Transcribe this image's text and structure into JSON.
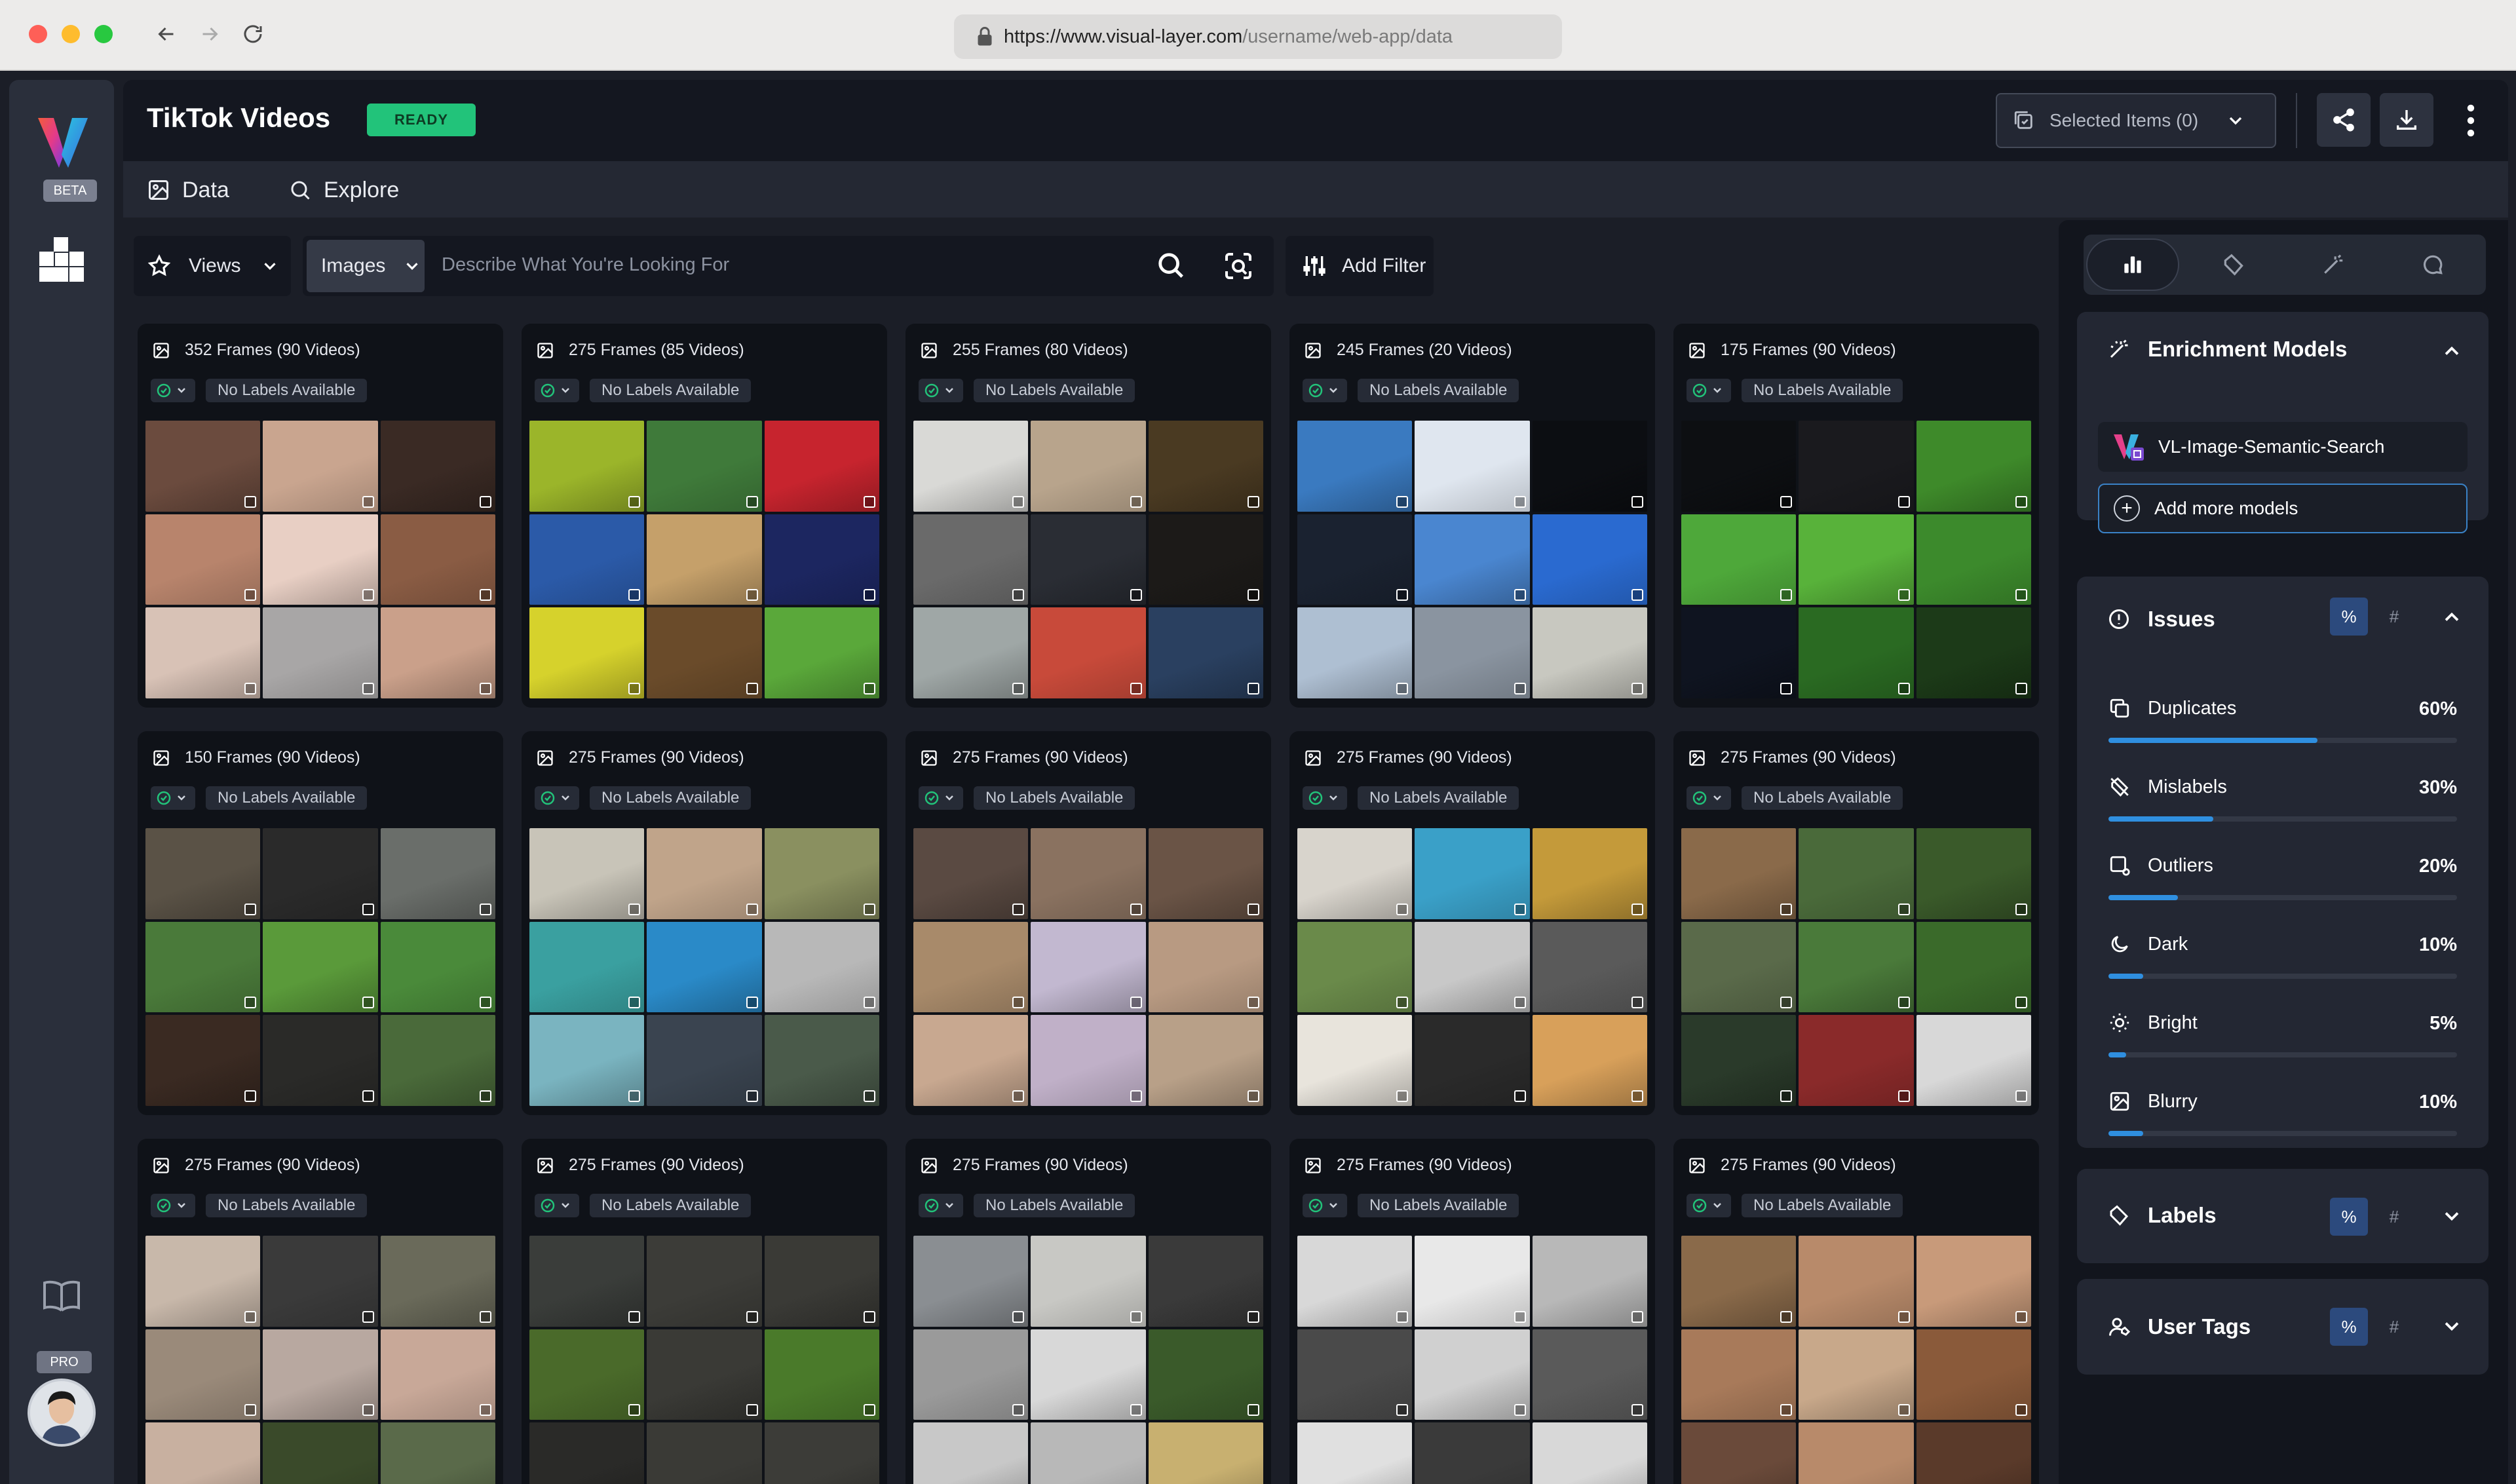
{
  "browser": {
    "url_base": "https://www.visual-layer.com",
    "url_path": "/username/web-app/data"
  },
  "rail": {
    "beta": "BETA",
    "pro": "PRO"
  },
  "header": {
    "title": "TikTok Videos",
    "status": "READY",
    "selected_items": "Selected Items (0)"
  },
  "tabs": {
    "data": "Data",
    "explore": "Explore"
  },
  "toolbar": {
    "views_label": "Views",
    "type_label": "Images",
    "search_placeholder": "Describe What You're Looking For",
    "add_filter_label": "Add Filter"
  },
  "no_labels": "No Labels Available",
  "cards": [
    {
      "frames": "352 Frames (90 Videos)",
      "palette": [
        "#6b4b3e",
        "#c9a58f",
        "#3a2a24",
        "#b8846c",
        "#e8cfc4",
        "#8a5c44",
        "#d8c2b6",
        "#a8a6a6",
        "#caa08a"
      ]
    },
    {
      "frames": "275 Frames (85 Videos)",
      "palette": [
        "#9bb52a",
        "#3f7a3a",
        "#c7242e",
        "#2b5aa8",
        "#c5a06a",
        "#1c2660",
        "#d6d22c",
        "#6a4b2a",
        "#5aa83a"
      ]
    },
    {
      "frames": "255 Frames (80 Videos)",
      "palette": [
        "#d9d9d6",
        "#b8a48c",
        "#4a3a22",
        "#6a6a6a",
        "#2a2d34",
        "#1c1a18",
        "#9fa7a6",
        "#c84a3a",
        "#2a4060"
      ]
    },
    {
      "frames": "245 Frames (20 Videos)",
      "palette": [
        "#3a7ac0",
        "#dfe6ef",
        "#0c0e12",
        "#1a2230",
        "#4a86d0",
        "#2a6ad0",
        "#aebfd2",
        "#8a94a0",
        "#c8c8c0"
      ]
    },
    {
      "frames": "175 Frames (90 Videos)",
      "palette": [
        "#0d0f12",
        "#1a1a1e",
        "#3e8a2a",
        "#4ea83a",
        "#58b23a",
        "#3c8a2c",
        "#0f1420",
        "#2a6a22",
        "#1c3a18"
      ]
    },
    {
      "frames": "150 Frames (90 Videos)",
      "palette": [
        "#5a5246",
        "#2a2a2a",
        "#6a6e6a",
        "#4a7a3a",
        "#5a9a3a",
        "#4a8a3a",
        "#3a2a22",
        "#2a2a28",
        "#4a6a3a"
      ]
    },
    {
      "frames": "275 Frames (90 Videos)",
      "palette": [
        "#c8c4b8",
        "#c0a48a",
        "#8a9060",
        "#3aa0a0",
        "#2a8ac8",
        "#b8b8b8",
        "#7ab4c0",
        "#3a4450",
        "#4a5a4a"
      ]
    },
    {
      "frames": "275 Frames (90 Videos)",
      "palette": [
        "#5a4a42",
        "#8a7260",
        "#6a5446",
        "#a88a6a",
        "#c2b8d0",
        "#b89a82",
        "#c8a890",
        "#c0b0c8",
        "#b8a088"
      ]
    },
    {
      "frames": "275 Frames (90 Videos)",
      "palette": [
        "#d8d4cc",
        "#3aa0c8",
        "#c49a3a",
        "#6a8a4a",
        "#c8c8c8",
        "#5a5a5a",
        "#e8e4dc",
        "#2a2a2a",
        "#d8a05a"
      ]
    },
    {
      "frames": "275 Frames (90 Videos)",
      "palette": [
        "#8a6a4a",
        "#4a6a3a",
        "#3a5a2a",
        "#5a6a4a",
        "#4a7a3a",
        "#3a6a2a",
        "#2a3a2a",
        "#8a2a2a",
        "#d8d8d8"
      ]
    },
    {
      "frames": "275 Frames (90 Videos)",
      "palette": [
        "#c8b8aa",
        "#3a3a3a",
        "#6a6a5a",
        "#9a8a7a",
        "#b8a8a0",
        "#c8a898",
        "#c8b0a0",
        "#3a4a2a",
        "#5a6a4a"
      ]
    },
    {
      "frames": "275 Frames (90 Videos)",
      "palette": [
        "#3a3d3a",
        "#3c3c38",
        "#3a3a36",
        "#4a6a2a",
        "#3a3a36",
        "#4a7a2a",
        "#2a2a28",
        "#3a3a36",
        "#3c3c38"
      ]
    },
    {
      "frames": "275 Frames (90 Videos)",
      "palette": [
        "#8a8e92",
        "#c8c8c4",
        "#3a3a3a",
        "#9a9a9a",
        "#d8d8d8",
        "#3a5a2a",
        "#c8c8c8",
        "#b8b8b8",
        "#c8b070"
      ]
    },
    {
      "frames": "275 Frames (90 Videos)",
      "palette": [
        "#d8d8d8",
        "#e8e8e8",
        "#b8b8b8",
        "#4a4a4a",
        "#d0d0d0",
        "#5a5a5a",
        "#e0e0e0",
        "#3a3a3a",
        "#d8d8d8"
      ]
    },
    {
      "frames": "275 Frames (90 Videos)",
      "palette": [
        "#8a6a4a",
        "#b88a6a",
        "#c89a7a",
        "#a87a5a",
        "#c8a88a",
        "#8a5a3a",
        "#6a4a3a",
        "#b88a6a",
        "#5a3a2a"
      ]
    }
  ],
  "panel": {
    "enrichment": {
      "title": "Enrichment Models",
      "model_name": "VL-Image-Semantic-Search",
      "add_label": "Add more models"
    },
    "issues": {
      "title": "Issues",
      "pct_label": "%",
      "num_label": "#",
      "items": [
        {
          "name": "Duplicates",
          "value": "60%",
          "fraction": 0.6
        },
        {
          "name": "Mislabels",
          "value": "30%",
          "fraction": 0.3
        },
        {
          "name": "Outliers",
          "value": "20%",
          "fraction": 0.2
        },
        {
          "name": "Dark",
          "value": "10%",
          "fraction": 0.1
        },
        {
          "name": "Bright",
          "value": "5%",
          "fraction": 0.05
        },
        {
          "name": "Blurry",
          "value": "10%",
          "fraction": 0.1
        }
      ]
    },
    "labels": {
      "title": "Labels"
    },
    "user_tags": {
      "title": "User Tags"
    }
  },
  "colors": {
    "accent": "#2f8fe0",
    "ready": "#22c37a",
    "background": "#1b1e27"
  }
}
